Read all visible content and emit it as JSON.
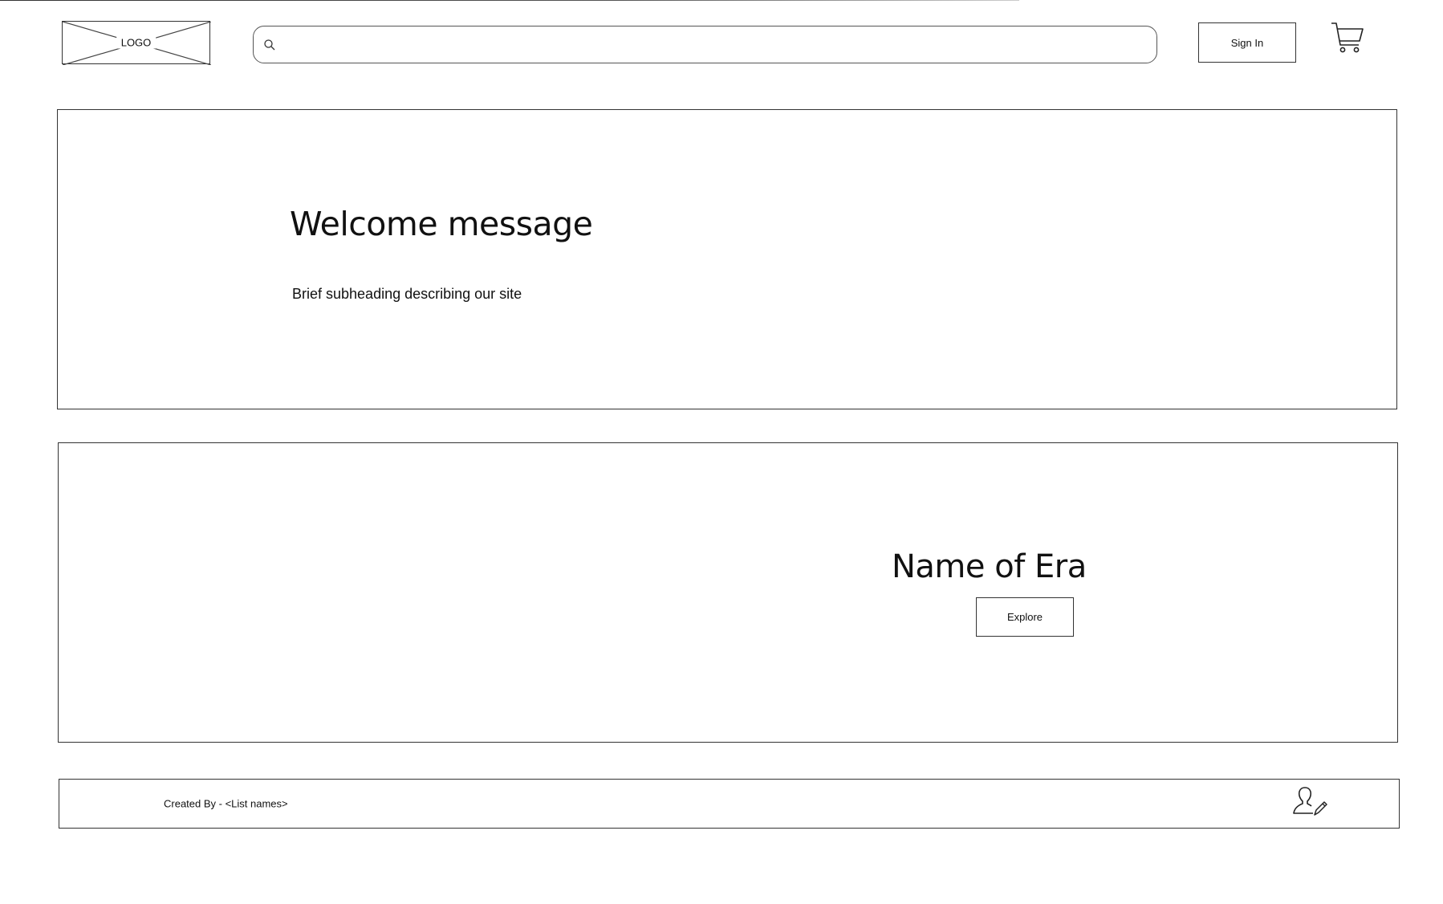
{
  "header": {
    "logo_text": "LOGO",
    "search_placeholder": "",
    "search_value": "",
    "sign_in_label": "Sign In",
    "icons": [
      "search-icon",
      "cart-icon"
    ]
  },
  "hero": {
    "title": "Welcome message",
    "subtitle": "Brief subheading describing our site"
  },
  "era": {
    "title": "Name of Era",
    "button_label": "Explore"
  },
  "footer": {
    "credits": "Created By - <List names>",
    "icon": "user-edit-icon"
  },
  "colors": {
    "stroke": "#333333",
    "background": "#ffffff"
  }
}
